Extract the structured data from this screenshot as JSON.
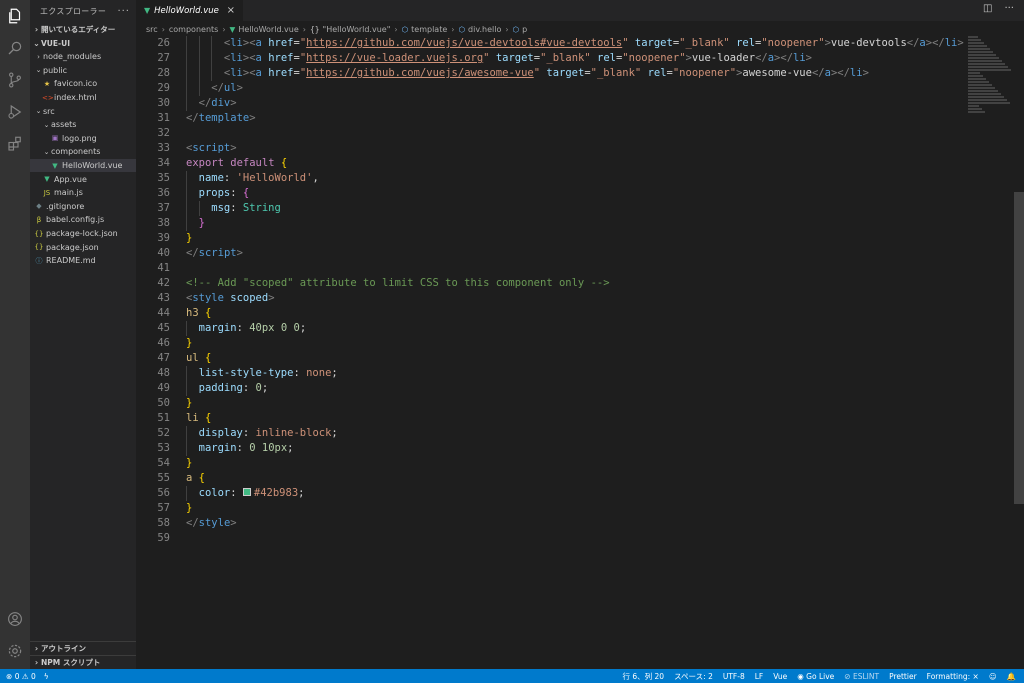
{
  "colors": {
    "accent": "#007acc",
    "vue_green": "#41b883",
    "swatch": "#42b983"
  },
  "sidebar": {
    "title": "エクスプローラー",
    "more": "···",
    "open_editors": "開いているエディター",
    "project": "VUE-UI",
    "tree": [
      {
        "label": "node_modules",
        "depth": 1,
        "kind": "folder",
        "expanded": false
      },
      {
        "label": "public",
        "depth": 1,
        "kind": "folder",
        "expanded": true
      },
      {
        "label": "favicon.ico",
        "depth": 2,
        "kind": "star",
        "color": "#e8c547"
      },
      {
        "label": "index.html",
        "depth": 2,
        "kind": "html",
        "color": "#e44d26"
      },
      {
        "label": "src",
        "depth": 1,
        "kind": "folder",
        "expanded": true
      },
      {
        "label": "assets",
        "depth": 2,
        "kind": "folder",
        "expanded": true
      },
      {
        "label": "logo.png",
        "depth": 3,
        "kind": "image",
        "color": "#a074c4"
      },
      {
        "label": "components",
        "depth": 2,
        "kind": "folder",
        "expanded": true
      },
      {
        "label": "HelloWorld.vue",
        "depth": 3,
        "kind": "vue",
        "color": "#41b883",
        "selected": true
      },
      {
        "label": "App.vue",
        "depth": 2,
        "kind": "vue",
        "color": "#41b883"
      },
      {
        "label": "main.js",
        "depth": 2,
        "kind": "js",
        "color": "#cbcb41"
      },
      {
        "label": ".gitignore",
        "depth": 1,
        "kind": "git",
        "color": "#6d8086"
      },
      {
        "label": "babel.config.js",
        "depth": 1,
        "kind": "babel",
        "color": "#cbcb41"
      },
      {
        "label": "package-lock.json",
        "depth": 1,
        "kind": "json",
        "color": "#cbcb41"
      },
      {
        "label": "package.json",
        "depth": 1,
        "kind": "json",
        "color": "#cbcb41"
      },
      {
        "label": "README.md",
        "depth": 1,
        "kind": "info",
        "color": "#519aba"
      }
    ],
    "outline": "アウトライン",
    "npm": "NPM スクリプト"
  },
  "tab": {
    "label": "HelloWorld.vue",
    "close": "×"
  },
  "breadcrumb": [
    "src",
    "components",
    "HelloWorld.vue",
    "\"HelloWorld.vue\"",
    "template",
    "div.hello",
    "p"
  ],
  "code_lines": [
    {
      "n": "26",
      "indent": 3,
      "html": "<span class='t-tag'>&lt;</span><span class='t-tagname'>li</span><span class='t-tag'>&gt;&lt;</span><span class='t-tagname'>a</span> <span class='t-attr'>href</span><span class='t-text'>=</span><span class='t-str'>\"</span><span class='t-link'>https://github.com/vuejs/vue-devtools#vue-devtools</span><span class='t-str'>\"</span> <span class='t-attr'>target</span><span class='t-text'>=</span><span class='t-str'>\"_blank\"</span> <span class='t-attr'>rel</span><span class='t-text'>=</span><span class='t-str'>\"noopener\"</span><span class='t-tag'>&gt;</span><span class='t-text'>vue-devtools</span><span class='t-tag'>&lt;/</span><span class='t-tagname'>a</span><span class='t-tag'>&gt;&lt;/</span><span class='t-tagname'>li</span><span class='t-tag'>&gt;</span>"
    },
    {
      "n": "27",
      "indent": 3,
      "html": "<span class='t-tag'>&lt;</span><span class='t-tagname'>li</span><span class='t-tag'>&gt;&lt;</span><span class='t-tagname'>a</span> <span class='t-attr'>href</span><span class='t-text'>=</span><span class='t-str'>\"</span><span class='t-link'>https://vue-loader.vuejs.org</span><span class='t-str'>\"</span> <span class='t-attr'>target</span><span class='t-text'>=</span><span class='t-str'>\"_blank\"</span> <span class='t-attr'>rel</span><span class='t-text'>=</span><span class='t-str'>\"noopener\"</span><span class='t-tag'>&gt;</span><span class='t-text'>vue-loader</span><span class='t-tag'>&lt;/</span><span class='t-tagname'>a</span><span class='t-tag'>&gt;&lt;/</span><span class='t-tagname'>li</span><span class='t-tag'>&gt;</span>"
    },
    {
      "n": "28",
      "indent": 3,
      "html": "<span class='t-tag'>&lt;</span><span class='t-tagname'>li</span><span class='t-tag'>&gt;&lt;</span><span class='t-tagname'>a</span> <span class='t-attr'>href</span><span class='t-text'>=</span><span class='t-str'>\"</span><span class='t-link'>https://github.com/vuejs/awesome-vue</span><span class='t-str'>\"</span> <span class='t-attr'>target</span><span class='t-text'>=</span><span class='t-str'>\"_blank\"</span> <span class='t-attr'>rel</span><span class='t-text'>=</span><span class='t-str'>\"noopener\"</span><span class='t-tag'>&gt;</span><span class='t-text'>awesome-vue</span><span class='t-tag'>&lt;/</span><span class='t-tagname'>a</span><span class='t-tag'>&gt;&lt;/</span><span class='t-tagname'>li</span><span class='t-tag'>&gt;</span>"
    },
    {
      "n": "29",
      "indent": 2,
      "html": "<span class='t-tag'>&lt;/</span><span class='t-tagname'>ul</span><span class='t-tag'>&gt;</span>"
    },
    {
      "n": "30",
      "indent": 1,
      "html": "<span class='t-tag'>&lt;/</span><span class='t-tagname'>div</span><span class='t-tag'>&gt;</span>"
    },
    {
      "n": "31",
      "indent": 0,
      "html": "<span class='t-tag'>&lt;/</span><span class='t-tagname'>template</span><span class='t-tag'>&gt;</span>"
    },
    {
      "n": "32",
      "indent": 0,
      "html": ""
    },
    {
      "n": "33",
      "indent": 0,
      "html": "<span class='t-tag'>&lt;</span><span class='t-tagname'>script</span><span class='t-tag'>&gt;</span>"
    },
    {
      "n": "34",
      "indent": 0,
      "html": "<span class='t-kw'>export</span> <span class='t-kw'>default</span> <span class='t-brace1'>{</span>"
    },
    {
      "n": "35",
      "indent": 1,
      "html": "<span class='t-prop'>name</span><span class='t-text'>: </span><span class='t-str'>'HelloWorld'</span><span class='t-text'>,</span>"
    },
    {
      "n": "36",
      "indent": 1,
      "html": "<span class='t-prop'>props</span><span class='t-text'>: </span><span class='t-brace2'>{</span>"
    },
    {
      "n": "37",
      "indent": 2,
      "html": "<span class='t-prop'>msg</span><span class='t-text'>: </span><span class='t-type'>String</span>"
    },
    {
      "n": "38",
      "indent": 1,
      "html": "<span class='t-brace2'>}</span>"
    },
    {
      "n": "39",
      "indent": 0,
      "html": "<span class='t-brace1'>}</span>"
    },
    {
      "n": "40",
      "indent": 0,
      "html": "<span class='t-tag'>&lt;/</span><span class='t-tagname'>script</span><span class='t-tag'>&gt;</span>"
    },
    {
      "n": "41",
      "indent": 0,
      "html": ""
    },
    {
      "n": "42",
      "indent": 0,
      "html": "<span class='t-comment'>&lt;!-- Add \"scoped\" attribute to limit CSS to this component only --&gt;</span>"
    },
    {
      "n": "43",
      "indent": 0,
      "html": "<span class='t-tag'>&lt;</span><span class='t-tagname'>style</span> <span class='t-attr'>scoped</span><span class='t-tag'>&gt;</span>"
    },
    {
      "n": "44",
      "indent": 0,
      "html": "<span class='t-sel'>h3</span> <span class='t-brace1'>{</span>"
    },
    {
      "n": "45",
      "indent": 1,
      "html": "<span class='t-cssprop'>margin</span><span class='t-text'>: </span><span class='t-num'>40px</span> <span class='t-num'>0</span> <span class='t-num'>0</span><span class='t-text'>;</span>"
    },
    {
      "n": "46",
      "indent": 0,
      "html": "<span class='t-brace1'>}</span>"
    },
    {
      "n": "47",
      "indent": 0,
      "html": "<span class='t-sel'>ul</span> <span class='t-brace1'>{</span>"
    },
    {
      "n": "48",
      "indent": 1,
      "html": "<span class='t-cssprop'>list-style-type</span><span class='t-text'>: </span><span class='t-val'>none</span><span class='t-text'>;</span>"
    },
    {
      "n": "49",
      "indent": 1,
      "html": "<span class='t-cssprop'>padding</span><span class='t-text'>: </span><span class='t-num'>0</span><span class='t-text'>;</span>"
    },
    {
      "n": "50",
      "indent": 0,
      "html": "<span class='t-brace1'>}</span>"
    },
    {
      "n": "51",
      "indent": 0,
      "html": "<span class='t-sel'>li</span> <span class='t-brace1'>{</span>"
    },
    {
      "n": "52",
      "indent": 1,
      "html": "<span class='t-cssprop'>display</span><span class='t-text'>: </span><span class='t-val'>inline-block</span><span class='t-text'>;</span>"
    },
    {
      "n": "53",
      "indent": 1,
      "html": "<span class='t-cssprop'>margin</span><span class='t-text'>: </span><span class='t-num'>0</span> <span class='t-num'>10px</span><span class='t-text'>;</span>"
    },
    {
      "n": "54",
      "indent": 0,
      "html": "<span class='t-brace1'>}</span>"
    },
    {
      "n": "55",
      "indent": 0,
      "html": "<span class='t-sel'>a</span> <span class='t-brace1'>{</span>"
    },
    {
      "n": "56",
      "indent": 1,
      "html": "<span class='t-cssprop'>color</span><span class='t-text'>: </span><span class='swatch' style='background:#42b983'></span><span class='t-val'>#42b983</span><span class='t-text'>;</span>"
    },
    {
      "n": "57",
      "indent": 0,
      "html": "<span class='t-brace1'>}</span>"
    },
    {
      "n": "58",
      "indent": 0,
      "html": "<span class='t-tag'>&lt;/</span><span class='t-tagname'>style</span><span class='t-tag'>&gt;</span>"
    },
    {
      "n": "59",
      "indent": 0,
      "html": ""
    }
  ],
  "status": {
    "errors": "0",
    "warnings": "0",
    "position": "行 6、列 20",
    "spaces": "スペース: 2",
    "encoding": "UTF-8",
    "eol": "LF",
    "language": "Vue",
    "golive": "Go Live",
    "eslint": "ESLINT",
    "prettier": "Prettier",
    "formatting": "Formatting: ×"
  }
}
